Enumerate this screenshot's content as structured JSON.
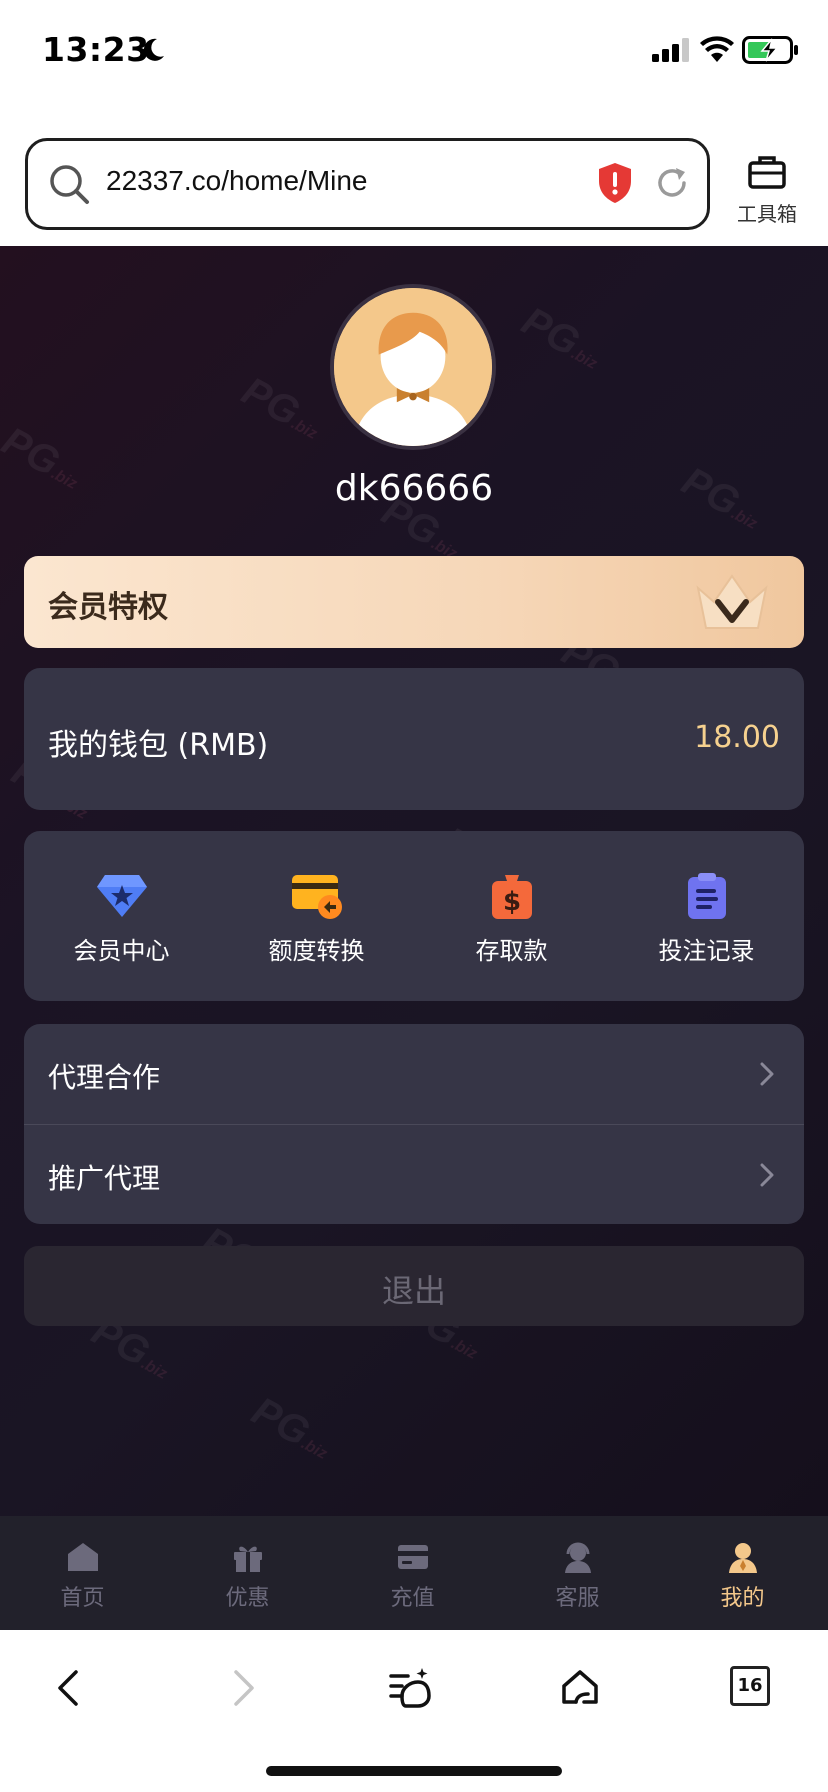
{
  "status_bar": {
    "time": "13:23"
  },
  "browser": {
    "url": "22337.co/home/Mine",
    "toolbox_label": "工具箱",
    "tab_count": "16"
  },
  "profile": {
    "username": "dk66666"
  },
  "vip": {
    "title": "会员特权"
  },
  "wallet": {
    "label": "我的钱包 (RMB)",
    "balance": "18.00"
  },
  "quick_actions": [
    {
      "label": "会员中心",
      "icon": "diamond-star-icon"
    },
    {
      "label": "额度转换",
      "icon": "card-transfer-icon"
    },
    {
      "label": "存取款",
      "icon": "money-bag-icon"
    },
    {
      "label": "投注记录",
      "icon": "clipboard-icon"
    }
  ],
  "menu": [
    {
      "label": "代理合作"
    },
    {
      "label": "推广代理"
    }
  ],
  "logout_label": "退出",
  "tabbar": [
    {
      "label": "首页",
      "icon": "home-icon"
    },
    {
      "label": "优惠",
      "icon": "gift-icon"
    },
    {
      "label": "充值",
      "icon": "wallet-icon"
    },
    {
      "label": "客服",
      "icon": "support-icon"
    },
    {
      "label": "我的",
      "icon": "user-icon",
      "active": true
    }
  ],
  "colors": {
    "accent_gold": "#f4c88b",
    "balance_gold": "#f6d18f",
    "card_bg": "#363546"
  }
}
